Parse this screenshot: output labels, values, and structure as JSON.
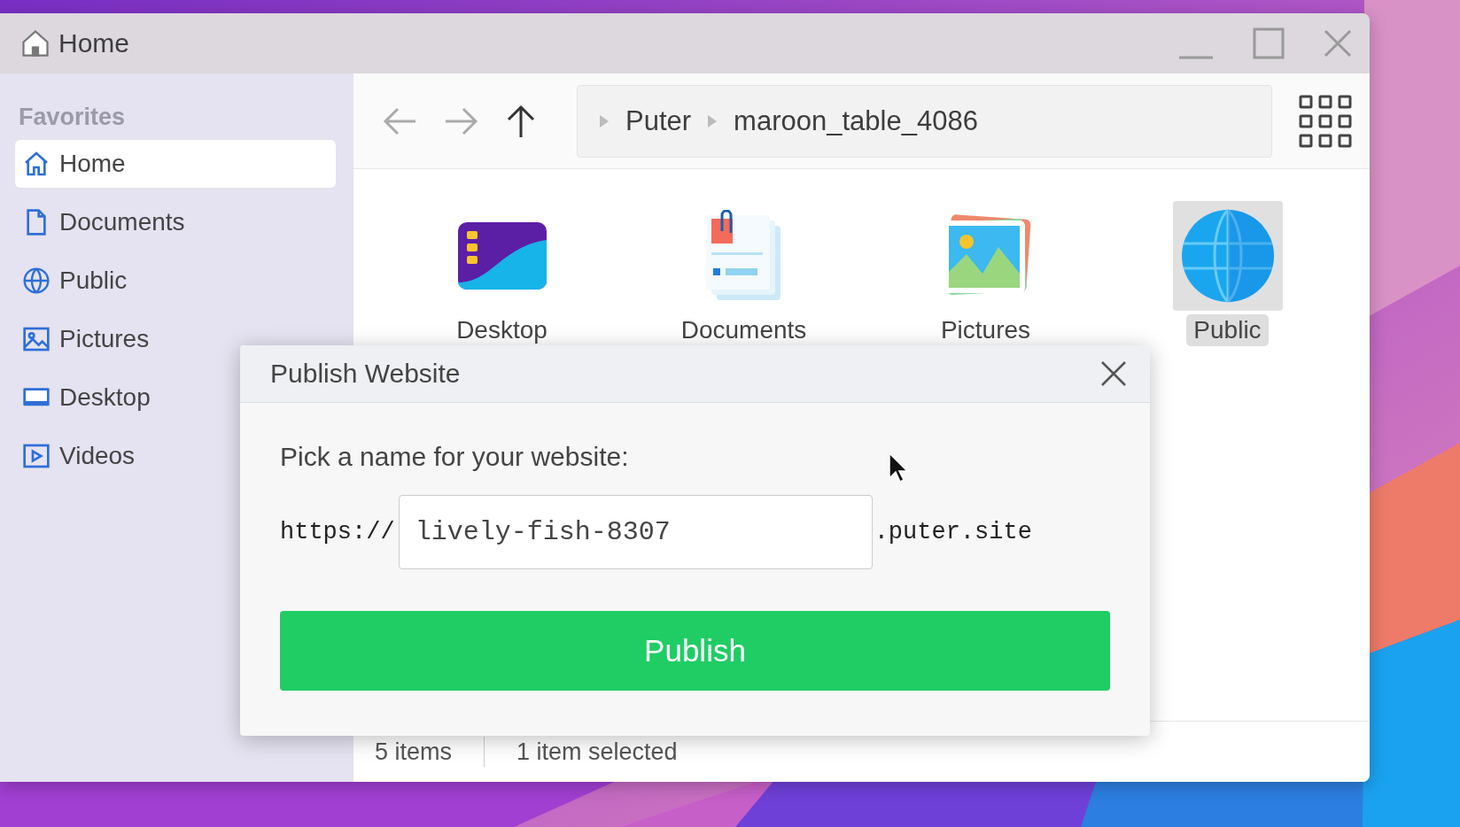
{
  "window": {
    "title": "Home"
  },
  "sidebar": {
    "heading": "Favorites",
    "items": [
      {
        "label": "Home",
        "selected": true
      },
      {
        "label": "Documents",
        "selected": false
      },
      {
        "label": "Public",
        "selected": false
      },
      {
        "label": "Pictures",
        "selected": false
      },
      {
        "label": "Desktop",
        "selected": false
      },
      {
        "label": "Videos",
        "selected": false
      }
    ]
  },
  "breadcrumb": [
    "Puter",
    "maroon_table_4086"
  ],
  "files": [
    {
      "name": "Desktop",
      "selected": false
    },
    {
      "name": "Documents",
      "selected": false
    },
    {
      "name": "Pictures",
      "selected": false
    },
    {
      "name": "Public",
      "selected": true
    }
  ],
  "status_bar": {
    "count": "5 items",
    "selection": "1 item selected"
  },
  "dialog": {
    "title": "Publish Website",
    "prompt": "Pick a name for your website:",
    "prefix": "https://",
    "value": "lively-fish-8307",
    "suffix": ".puter.site",
    "button": "Publish"
  }
}
